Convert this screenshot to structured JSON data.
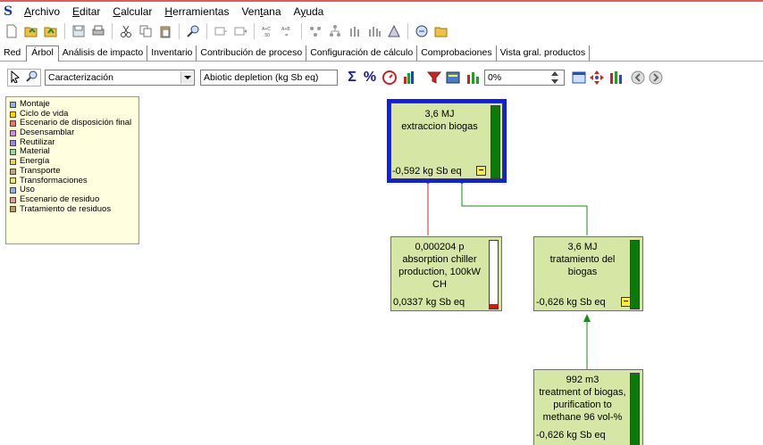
{
  "menu": {
    "items": [
      {
        "pre": "",
        "ul": "A",
        "post": "rchivo"
      },
      {
        "pre": "",
        "ul": "E",
        "post": "ditar"
      },
      {
        "pre": "",
        "ul": "C",
        "post": "alcular"
      },
      {
        "pre": "",
        "ul": "H",
        "post": "erramientas"
      },
      {
        "pre": "Ven",
        "ul": "t",
        "post": "ana"
      },
      {
        "pre": "A",
        "ul": "y",
        "post": "uda"
      }
    ]
  },
  "tabs": {
    "items": [
      "Red",
      "Árbol",
      "Análisis de impacto",
      "Inventario",
      "Contribución de proceso",
      "Configuración de cálculo",
      "Comprobaciones",
      "Vista gral. productos"
    ]
  },
  "controls": {
    "method": "Caracterización",
    "category": "Abiotic depletion (kg Sb eq)",
    "cutoff": "0%"
  },
  "legend": {
    "items": [
      {
        "label": "Montaje",
        "color": "#8ab4e6"
      },
      {
        "label": "Ciclo de vida",
        "color": "#ffd700"
      },
      {
        "label": "Escenario de disposición final",
        "color": "#e07a7a"
      },
      {
        "label": "Desensamblar",
        "color": "#d88ad8"
      },
      {
        "label": "Reutilizar",
        "color": "#9a8ad8"
      },
      {
        "label": "Material",
        "color": "#9ad8a8"
      },
      {
        "label": "Energía",
        "color": "#e8d060"
      },
      {
        "label": "Transporte",
        "color": "#bca888"
      },
      {
        "label": "Transformaciones",
        "color": "#e8e880"
      },
      {
        "label": "Uso",
        "color": "#8ab4e6"
      },
      {
        "label": "Escenario de residuo",
        "color": "#d8a0a0"
      },
      {
        "label": "Tratamiento de residuos",
        "color": "#b0a070"
      }
    ]
  },
  "nodes": {
    "root": {
      "label": "3,6 MJ\nextraccion biogas",
      "value": "-0,592 kg Sb eq",
      "fill_fraction": 1.0,
      "fill_color": "#0a7a0a"
    },
    "chiller": {
      "label": "0,000204 p\nabsorption chiller\nproduction, 100kW\nCH",
      "value": "0,0337 kg Sb eq",
      "fill_fraction": 0.06,
      "fill_color": "#e01010"
    },
    "biogas": {
      "label": "3,6 MJ\ntratamiento del\nbiogas",
      "value": "-0,626 kg Sb eq",
      "fill_fraction": 1.0,
      "fill_color": "#0a7a0a"
    },
    "treatment": {
      "label": "992 m3\ntreatment of biogas,\npurification to\nmethane 96 vol-%",
      "value": "-0,626 kg Sb eq",
      "fill_fraction": 1.0,
      "fill_color": "#0a7a0a"
    }
  },
  "links": {
    "negative_color": "#1a8a1a",
    "positive_color": "#e02020"
  }
}
